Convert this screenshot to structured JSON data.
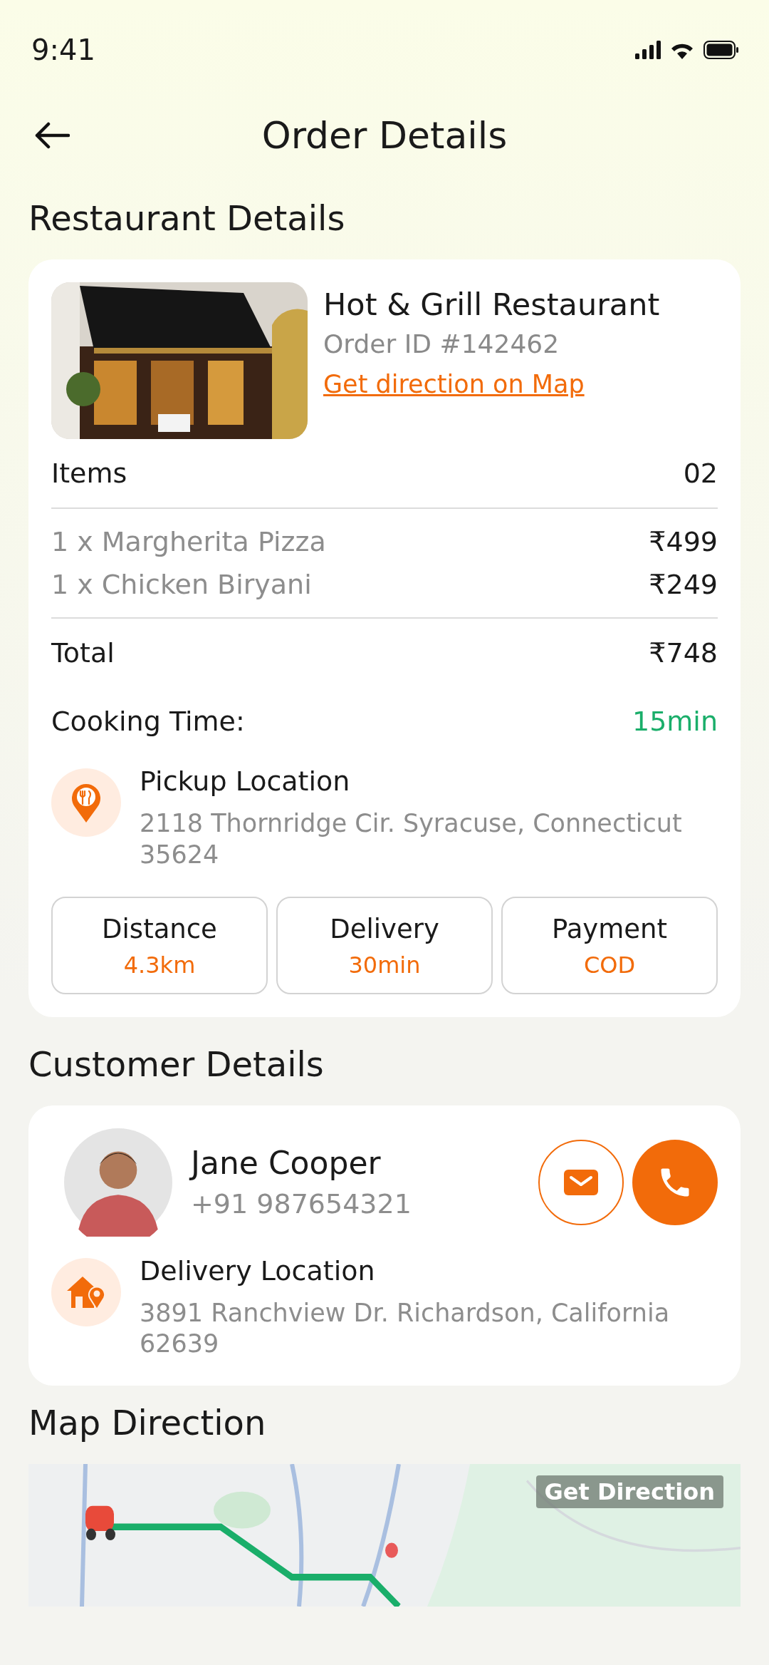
{
  "status_bar": {
    "time": "9:41"
  },
  "header": {
    "title": "Order Details"
  },
  "restaurant_section": {
    "heading": "Restaurant Details",
    "name": "Hot & Grill Restaurant",
    "order_id": "Order ID #142462",
    "map_link": "Get direction on Map",
    "items_label": "Items",
    "items_count": "02",
    "items": [
      {
        "name": "1 x Margherita Pizza",
        "price": "₹499"
      },
      {
        "name": "1 x Chicken Biryani",
        "price": "₹249"
      }
    ],
    "total_label": "Total",
    "total": "₹748",
    "cooking_label": "Cooking Time:",
    "cooking_time": "15min",
    "pickup": {
      "title": "Pickup Location",
      "address": "2118 Thornridge Cir. Syracuse, Connecticut 35624"
    },
    "stats": [
      {
        "label": "Distance",
        "value": "4.3km"
      },
      {
        "label": "Delivery",
        "value": "30min"
      },
      {
        "label": "Payment",
        "value": "COD"
      }
    ]
  },
  "customer_section": {
    "heading": "Customer Details",
    "name": "Jane Cooper",
    "phone": "+91 987654321",
    "delivery": {
      "title": "Delivery Location",
      "address": "3891 Ranchview Dr. Richardson, California 62639"
    }
  },
  "map_section": {
    "heading": "Map Direction",
    "button": "Get Direction"
  }
}
